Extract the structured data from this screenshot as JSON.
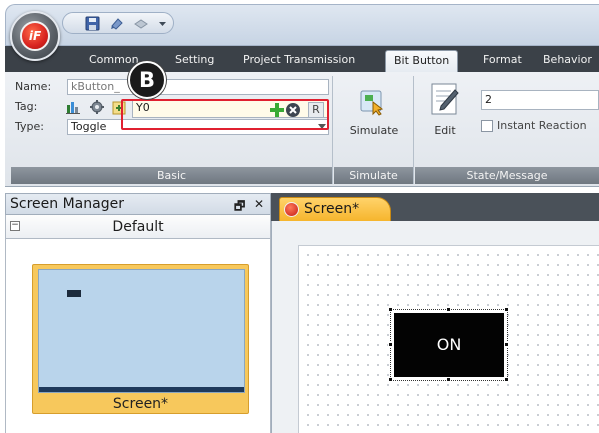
{
  "app": {
    "logo_text": "iF"
  },
  "quick_access": {
    "items": [
      "save-icon",
      "undo-icon",
      "redo-icon",
      "customize-dropdown-icon"
    ]
  },
  "ribbon_tabs": [
    {
      "label": "Common",
      "active": false
    },
    {
      "label": "Setting",
      "active": false
    },
    {
      "label": "Project Transmission",
      "active": false
    },
    {
      "label": "Bit Button",
      "active": true
    },
    {
      "label": "Format",
      "active": false
    },
    {
      "label": "Behavior",
      "active": false
    }
  ],
  "basic_group": {
    "label": "Basic",
    "name_label": "Name:",
    "name_value": "kButton_",
    "tag_label": "Tag:",
    "tag_value": "Y0",
    "tag_r_button": "R",
    "type_label": "Type:",
    "type_value": "Toggle"
  },
  "simulate_group": {
    "label": "Simulate",
    "button_label": "Simulate"
  },
  "state_group": {
    "label": "State/Message",
    "edit_label": "Edit",
    "state_value": "2",
    "instant_reaction_label": "Instant Reaction",
    "instant_reaction_checked": false
  },
  "annotation": {
    "badge_letter": "B",
    "highlight_color": "#e02030"
  },
  "screen_manager": {
    "title": "Screen Manager",
    "pin_glyph": "🗗",
    "close_glyph": "✕",
    "group_title": "Default",
    "collapse_glyph": "−",
    "screens": [
      {
        "label": "Screen*",
        "selected": true
      }
    ]
  },
  "editor": {
    "tab_label": "Screen*",
    "button_text": "ON"
  },
  "colors": {
    "accent_tab": "#f6b52d",
    "ribbon_dark": "#3b4148",
    "button_black": "#030303"
  }
}
